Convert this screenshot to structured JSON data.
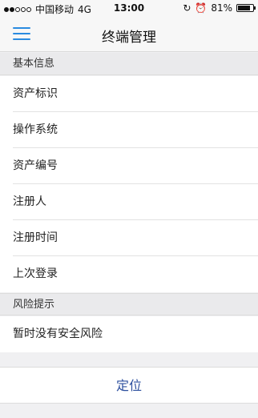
{
  "status_bar": {
    "carrier": "中国移动",
    "network": "4G",
    "time": "13:00",
    "battery_percent": "81%",
    "battery_level": 0.81
  },
  "nav": {
    "title": "终端管理",
    "menu_icon": "hamburger-menu-icon",
    "accent_color": "#2a8be0"
  },
  "sections": {
    "basic_info": {
      "header": "基本信息",
      "rows": [
        "资产标识",
        "操作系统",
        "资产编号",
        "注册人",
        "注册时间",
        "上次登录"
      ]
    },
    "risk": {
      "header": "风险提示",
      "rows": [
        "暂时没有安全风险"
      ]
    }
  },
  "locate_button": {
    "label": "定位",
    "color": "#2c4f9e"
  }
}
